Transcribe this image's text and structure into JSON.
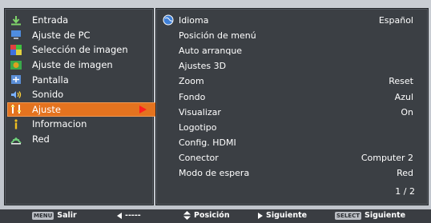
{
  "sidebar": {
    "items": [
      {
        "label": "Entrada",
        "icon": "input-icon",
        "active": false
      },
      {
        "label": "Ajuste de PC",
        "icon": "pc-adjust-icon",
        "active": false
      },
      {
        "label": "Selección de imagen",
        "icon": "image-select-icon",
        "active": false
      },
      {
        "label": "Ajuste de imagen",
        "icon": "image-adjust-icon",
        "active": false
      },
      {
        "label": "Pantalla",
        "icon": "screen-icon",
        "active": false
      },
      {
        "label": "Sonido",
        "icon": "sound-icon",
        "active": false
      },
      {
        "label": "Ajuste",
        "icon": "setting-icon",
        "active": true
      },
      {
        "label": "Informacion",
        "icon": "info-icon",
        "active": false
      },
      {
        "label": "Red",
        "icon": "network-icon",
        "active": false
      }
    ]
  },
  "settings": {
    "rows": [
      {
        "label": "Idioma",
        "value": "Español"
      },
      {
        "label": "Posición de menú",
        "value": ""
      },
      {
        "label": "Auto arranque",
        "value": ""
      },
      {
        "label": "Ajustes 3D",
        "value": ""
      },
      {
        "label": "Zoom",
        "value": "Reset"
      },
      {
        "label": "Fondo",
        "value": "Azul"
      },
      {
        "label": "Visualizar",
        "value": "On"
      },
      {
        "label": "Logotipo",
        "value": ""
      },
      {
        "label": "Config. HDMI",
        "value": ""
      },
      {
        "label": "Conector",
        "value": "Computer 2"
      },
      {
        "label": "Modo de espera",
        "value": "Red"
      }
    ],
    "page_indicator": "1 / 2"
  },
  "footer": {
    "menu_badge": "MENU",
    "exit_label": "Salir",
    "back_label": "-----",
    "position_label": "Posición",
    "next_label": "Siguiente",
    "select_badge": "SELECT",
    "select_label": "Siguiente"
  },
  "colors": {
    "active_bg": "#e4731f",
    "arrow": "#ff1f1f",
    "panel_bg": "#3b3f44"
  }
}
